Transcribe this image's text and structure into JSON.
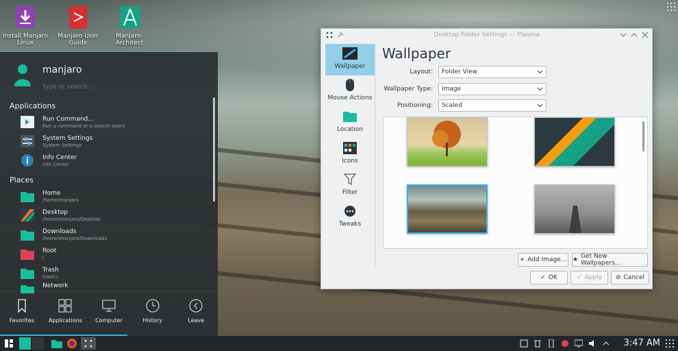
{
  "desktop": {
    "icons": [
      {
        "label": "Install Manjaro Linux",
        "icon": "download-icon"
      },
      {
        "label": "Manjaro User Guide",
        "icon": "pdf-icon"
      },
      {
        "label": "Manjaro-Architect",
        "icon": "architect-icon"
      }
    ]
  },
  "menu": {
    "user": "manjaro",
    "search_placeholder": "Type to search...",
    "applications_title": "Applications",
    "applications": [
      {
        "title": "Run Command...",
        "subtitle": "Run a command or a search query",
        "icon": "terminal-icon"
      },
      {
        "title": "System Settings",
        "subtitle": "System Settings",
        "icon": "settings-icon"
      },
      {
        "title": "Info Center",
        "subtitle": "Info Center",
        "icon": "info-icon"
      }
    ],
    "places_title": "Places",
    "places": [
      {
        "title": "Home",
        "subtitle": "/home/manjaro",
        "icon": "home-folder-icon"
      },
      {
        "title": "Desktop",
        "subtitle": "/home/manjaro/Desktop",
        "icon": "desktop-folder-icon"
      },
      {
        "title": "Downloads",
        "subtitle": "/home/manjaro/Downloads",
        "icon": "downloads-folder-icon"
      },
      {
        "title": "Root",
        "subtitle": "/",
        "icon": "root-folder-icon"
      },
      {
        "title": "Trash",
        "subtitle": "trash:/",
        "icon": "trash-folder-icon"
      },
      {
        "title": "Network",
        "subtitle": "",
        "icon": "network-folder-icon"
      }
    ],
    "tabs": [
      "Favorites",
      "Applications",
      "Computer",
      "History",
      "Leave"
    ]
  },
  "taskbar": {
    "clock": "3:47 AM"
  },
  "dialog": {
    "title": "Desktop Folder Settings — Plasma",
    "sidebar": [
      "Wallpaper",
      "Mouse Actions",
      "Location",
      "Icons",
      "Filter",
      "Tweaks"
    ],
    "heading": "Wallpaper",
    "layout_label": "Layout:",
    "layout_value": "Folder View",
    "type_label": "Wallpaper Type:",
    "type_value": "Image",
    "positioning_label": "Positioning:",
    "positioning_value": "Scaled",
    "add_image": "Add Image...",
    "get_new": "Get New Wallpapers...",
    "ok": "OK",
    "apply": "Apply",
    "cancel": "Cancel"
  },
  "colors": {
    "accent": "#3daee9",
    "manjaro_green": "#35bf5c",
    "folder_teal": "#1abc9c"
  }
}
